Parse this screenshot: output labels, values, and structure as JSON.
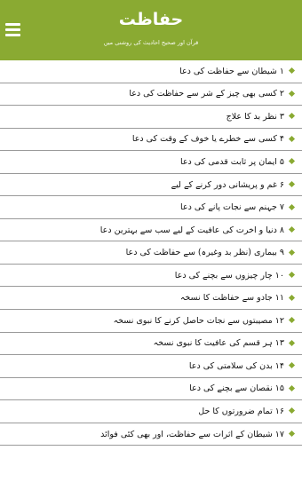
{
  "header": {
    "title": "حفاظت",
    "subtitle": "قرآن اور صحیح احادیث کی روشنی میں"
  },
  "colors": {
    "app_bar": "#8aaa32",
    "bullet": "#8aaa32",
    "divider": "#9a9a9a"
  },
  "icons": {
    "menu": "hamburger-menu-icon",
    "bullet": "diamond-bullet-icon"
  },
  "items": [
    "۱ شیطان سے حفاظت کی دعا",
    "۲ کسی بھی چیز کے شر سے حفاظت کی دعا",
    "۳ نظر بد کا علاج",
    "۴ کسی سے خطرے یا خوف کے وقت کی دعا",
    "۵ ایمان پر ثابت قدمی کی دعا",
    "۶ غم و پریشانی دور کرنے کے لیے",
    "۷ جہنم سے نجات پانے کی دعا",
    "۸ دنیا و آخرت کی عافیت کے لیے سب سے بہترین دعا",
    "۹ بیماری (نظر بد وغیرہ) سے حفاظت کی دعا",
    "۱۰ چار چیزوں سے بچنے کی دعا",
    "۱۱ جادو سے حفاظت کا نسخہ",
    "۱۲ مصیبتوں سے نجات حاصل کرنے کا نبوی نسخہ",
    "۱۳ ہر قسم کی عافیت کا نبوی نسخہ",
    "۱۴ بدن کی سلامتی کی دعا",
    "۱۵ نقصان سے بچنے کی دعا",
    "۱۶ تمام ضرورتوں کا حل",
    "۱۷ شیطان کے اثرات سے حفاظت، اور بھی کئی فوائد"
  ]
}
